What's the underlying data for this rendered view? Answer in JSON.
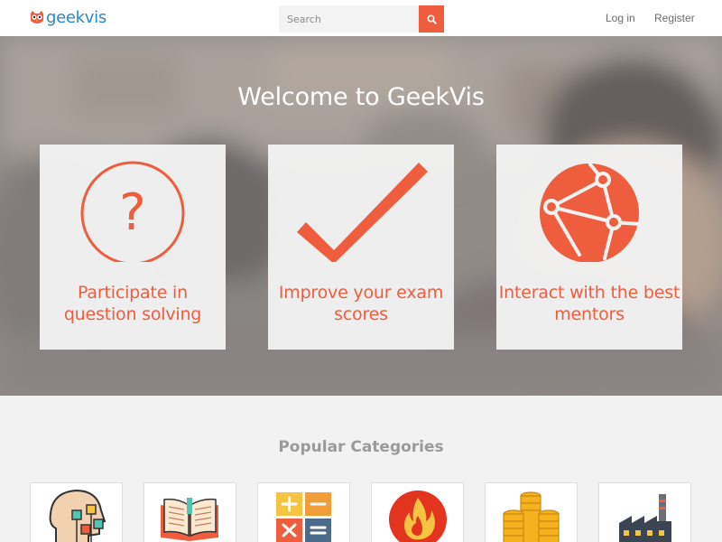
{
  "header": {
    "logo_text": "geekvis",
    "search": {
      "placeholder": "Search",
      "value": ""
    },
    "nav": {
      "login": "Log in",
      "register": "Register"
    }
  },
  "hero": {
    "title": "Welcome to GeekVis",
    "cards": [
      {
        "icon": "question-circle-icon",
        "text": "Participate in question solving"
      },
      {
        "icon": "checkmark-icon",
        "text": "Improve your exam scores"
      },
      {
        "icon": "network-globe-icon",
        "text": "Interact with the best mentors"
      }
    ]
  },
  "categories": {
    "heading": "Popular Categories",
    "items": [
      {
        "icon": "head-puzzle-icon"
      },
      {
        "icon": "open-book-icon"
      },
      {
        "icon": "calculator-icon"
      },
      {
        "icon": "fire-icon"
      },
      {
        "icon": "coin-stack-icon"
      },
      {
        "icon": "factory-icon"
      }
    ]
  },
  "colors": {
    "accent": "#ef5d3f",
    "logo_blue": "#2e86c9",
    "background": "#f2f2f2"
  }
}
